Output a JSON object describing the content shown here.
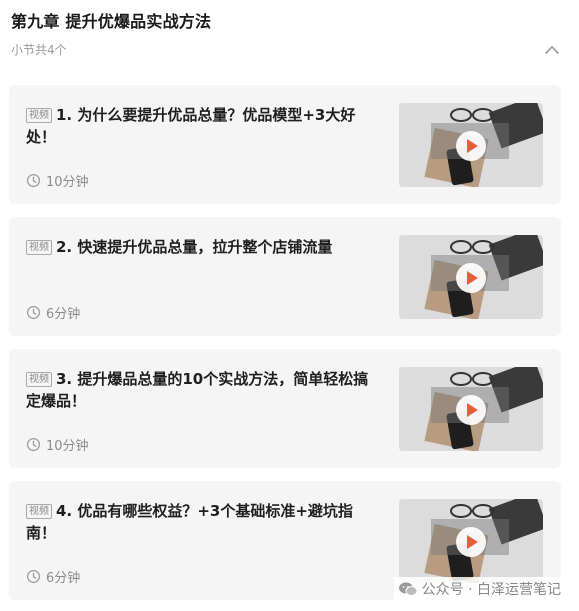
{
  "chapter": {
    "title": "第九章 提升优爆品实战方法",
    "section_count": "小节共4个"
  },
  "lessons": [
    {
      "tag": "视频",
      "title": "1. 为什么要提升优品总量？优品模型+3大好处！",
      "duration": "10分钟"
    },
    {
      "tag": "视频",
      "title": "2. 快速提升优品总量，拉升整个店铺流量",
      "duration": "6分钟"
    },
    {
      "tag": "视频",
      "title": "3. 提升爆品总量的10个实战方法，简单轻松搞定爆品！",
      "duration": "10分钟"
    },
    {
      "tag": "视频",
      "title": "4. 优品有哪些权益？+3个基础标准+避坑指南！",
      "duration": "6分钟"
    }
  ],
  "watermark": {
    "text": "公众号 · 白泽运营笔记"
  },
  "icons": {
    "collapse": "chevron-up-icon",
    "duration": "clock-icon",
    "play": "play-icon",
    "watermark": "wechat-icon"
  },
  "colors": {
    "card_bg": "#f5f5f5",
    "play_accent": "#f05a3c",
    "muted_text": "#8c8c8c"
  }
}
